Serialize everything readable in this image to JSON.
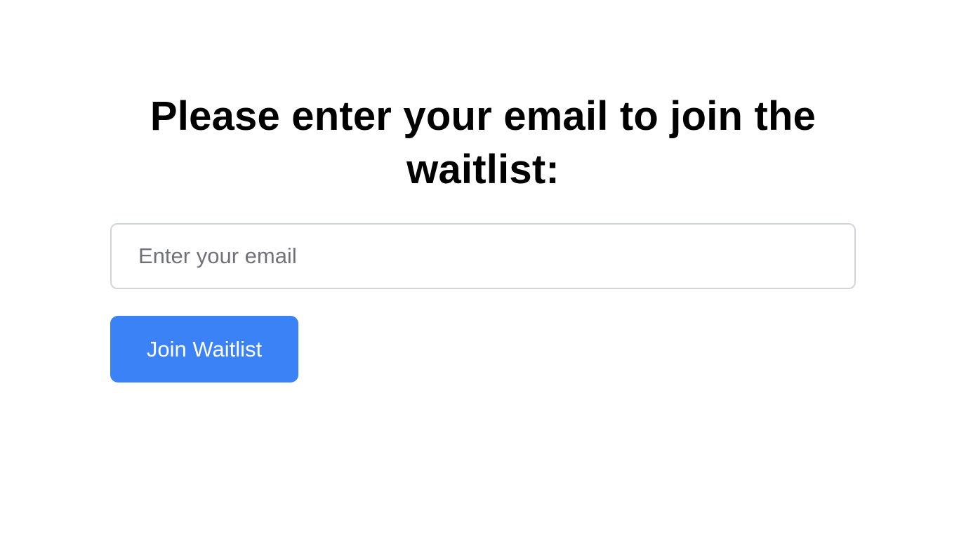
{
  "waitlist": {
    "heading": "Please enter your email to join the waitlist:",
    "email_placeholder": "Enter your email",
    "email_value": "",
    "button_label": "Join Waitlist"
  },
  "colors": {
    "button_background": "#3b82f6",
    "button_text": "#ffffff",
    "input_border": "#d1d5db",
    "placeholder_text": "#71717a",
    "heading_text": "#000000"
  }
}
